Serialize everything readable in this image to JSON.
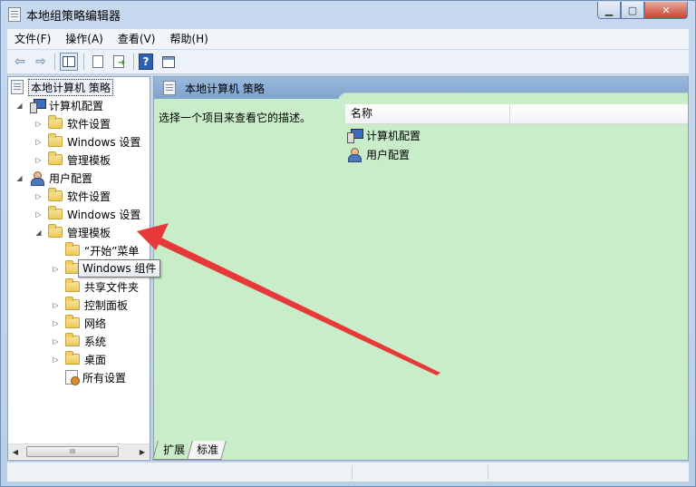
{
  "window": {
    "title": "本地组策略编辑器"
  },
  "menu": [
    "文件(F)",
    "操作(A)",
    "查看(V)",
    "帮助(H)"
  ],
  "tree": {
    "root": "本地计算机 策略",
    "computer_config": "计算机配置",
    "computer_children": [
      "软件设置",
      "Windows 设置",
      "管理模板"
    ],
    "user_config": "用户配置",
    "user_children": [
      "软件设置",
      "Windows 设置",
      "管理模板"
    ],
    "admin_templates_children": [
      "“开始”菜单",
      "Windows 组件",
      "共享文件夹",
      "控制面板",
      "网络",
      "系统",
      "桌面",
      "所有设置"
    ]
  },
  "tooltip": "Windows 组件",
  "content": {
    "header_title": "本地计算机 策略",
    "description": "选择一个项目来查看它的描述。",
    "column_name": "名称",
    "items": [
      "计算机配置",
      "用户配置"
    ]
  },
  "tabs": [
    "扩展",
    "标准"
  ],
  "scrollbar": {
    "thumb_grip": "III"
  },
  "colors": {
    "content_background": "#c8edc8",
    "header_blue": "#8fb0d8",
    "arrow_red": "#e8393a"
  }
}
